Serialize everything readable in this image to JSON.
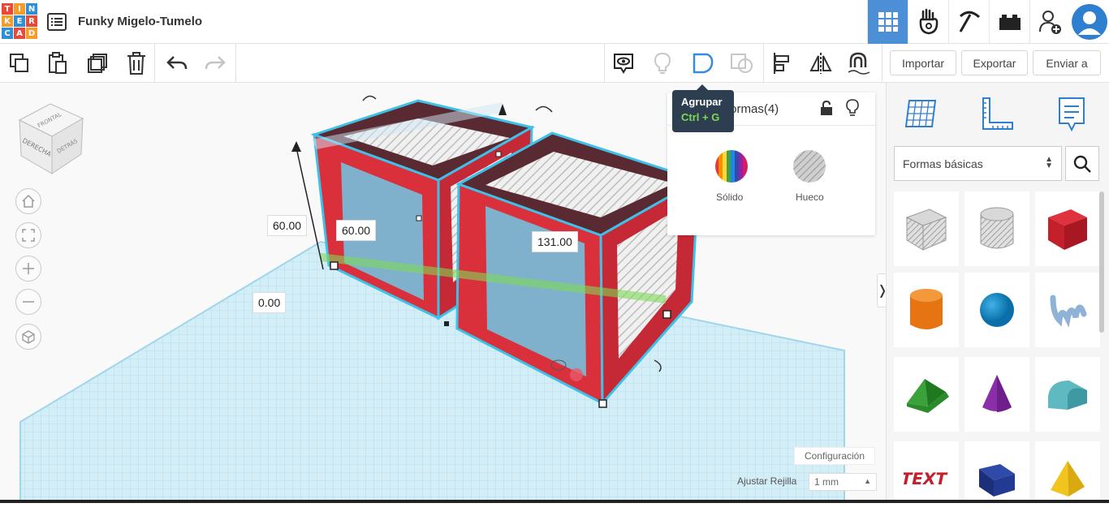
{
  "app": {
    "logo_letters": [
      "T",
      "I",
      "N",
      "K",
      "E",
      "R",
      "C",
      "A",
      "D"
    ],
    "logo_colors": [
      "#e84a3a",
      "#f59c2a",
      "#2f8fd6",
      "#f59c2a",
      "#2f8fd6",
      "#e84a3a",
      "#2f8fd6",
      "#e84a3a",
      "#f59c2a"
    ],
    "title": "Funky Migelo-Tumelo"
  },
  "topbar": {
    "buttons": [
      "grid-view-icon",
      "hand-icon",
      "pickaxe-icon",
      "bricks-icon",
      "add-user-icon",
      "avatar"
    ],
    "active_color": "#4d8fd6"
  },
  "toolbar": {
    "left_tools": [
      "copy-icon",
      "paste-icon",
      "duplicate-icon",
      "delete-icon",
      "undo-icon",
      "redo-icon"
    ],
    "right_tools": [
      "comment-icon",
      "light-icon",
      "group-icon",
      "ungroup-icon",
      "align-icon",
      "mirror-icon",
      "magnet-icon"
    ],
    "import_label": "Importar",
    "export_label": "Exportar",
    "send_label": "Enviar a"
  },
  "viewcube": {
    "front": "DERECHA",
    "side": "DETRÁS",
    "top": "FRONTAL"
  },
  "dimensions": {
    "height": "60.00",
    "width": "60.00",
    "length": "131.00",
    "elevation": "0.00"
  },
  "shape_panel": {
    "title": "Formas(4)",
    "solid_label": "Sólido",
    "hole_label": "Hueco"
  },
  "tooltip": {
    "label": "Agrupar",
    "shortcut": "Ctrl + G"
  },
  "right_panel": {
    "category": "Formas básicas",
    "shapes": [
      "box-hole",
      "cylinder-hole",
      "box",
      "cylinder",
      "sphere",
      "scribble",
      "roof",
      "cone",
      "round-roof",
      "text",
      "prism",
      "pyramid"
    ]
  },
  "bottom": {
    "config_label": "Configuración",
    "snap_label": "Ajustar Rejilla",
    "snap_value": "1 mm"
  },
  "colors": {
    "shape_red": "#d9303c",
    "outline_blue": "#3fc0e8",
    "grid_blue": "#bfe3f2",
    "accent": "#4d8fd6"
  }
}
